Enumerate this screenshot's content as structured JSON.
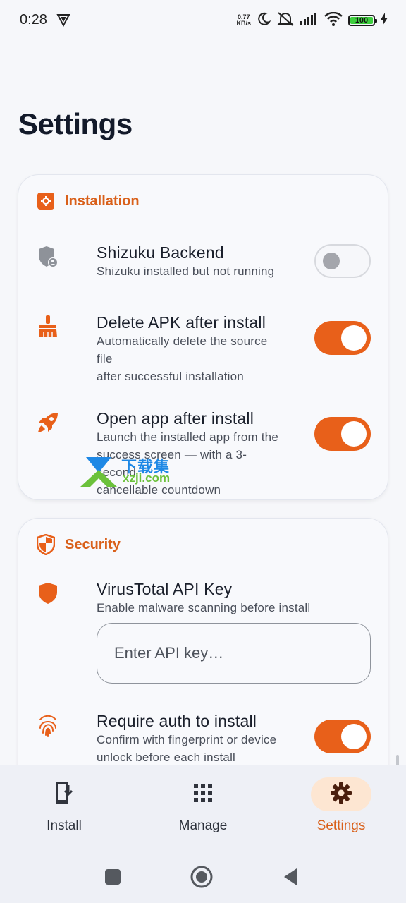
{
  "status_bar": {
    "time": "0:28",
    "net_speed_value": "0.77",
    "net_speed_unit": "KB/s",
    "battery_level": "100"
  },
  "page": {
    "title": "Settings"
  },
  "installation": {
    "header": "Installation",
    "shizuku": {
      "title": "Shizuku Backend",
      "subtitle": "Shizuku installed but not running",
      "enabled": false
    },
    "delete_apk": {
      "title": "Delete APK after install",
      "subtitle_line1": "Automatically delete the source file",
      "subtitle_line2": "after successful installation",
      "enabled": true
    },
    "open_app": {
      "title": "Open app after install",
      "subtitle_line1": "Launch the installed app from the",
      "subtitle_line2": "success screen — with a 3-second",
      "subtitle_line3": "cancellable countdown",
      "enabled": true
    }
  },
  "security": {
    "header": "Security",
    "virustotal": {
      "title": "VirusTotal API Key",
      "subtitle": "Enable malware scanning before install",
      "placeholder": "Enter API key…"
    },
    "require_auth": {
      "title": "Require auth to install",
      "subtitle_line1": "Confirm with fingerprint or device",
      "subtitle_line2": "unlock before each install",
      "enabled": true
    }
  },
  "watermark": {
    "text": "下载集",
    "domain": "xzji.com"
  },
  "bottom_nav": {
    "install": "Install",
    "manage": "Manage",
    "settings": "Settings",
    "active": "settings"
  },
  "colors": {
    "accent": "#e8601a",
    "accent_text": "#d9601a",
    "active_pill": "#fde6d2",
    "background": "#f6f7fa"
  },
  "icons": {
    "installation": "gear-square-icon",
    "shizuku": "shield-user-icon",
    "delete_apk": "broom-icon",
    "open_app": "rocket-icon",
    "security": "shield-icon",
    "virustotal": "shield-icon",
    "require_auth": "fingerprint-icon"
  }
}
